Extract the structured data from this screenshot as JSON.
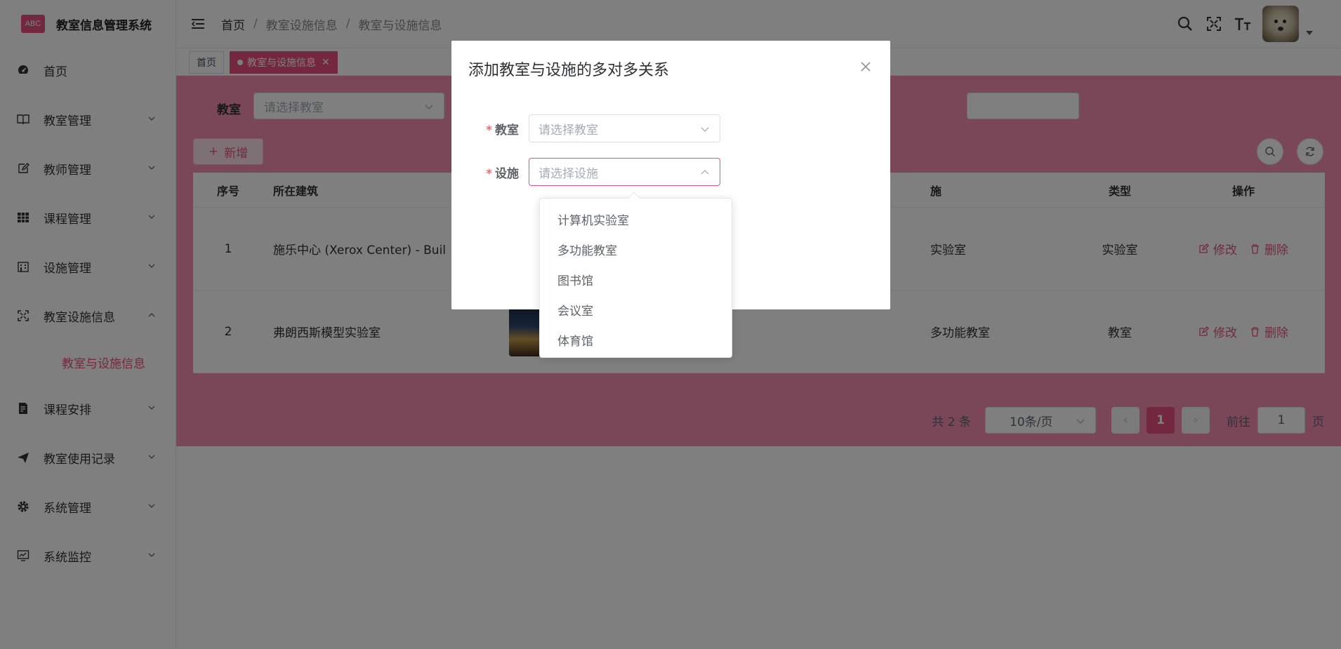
{
  "app": {
    "logo_text": "ABC",
    "title": "教室信息管理系统"
  },
  "sidebar": {
    "items": [
      {
        "label": "首页",
        "icon": "dashboard-icon",
        "expandable": false
      },
      {
        "label": "教室管理",
        "icon": "book-icon",
        "expandable": true
      },
      {
        "label": "教师管理",
        "icon": "edit-icon",
        "expandable": true
      },
      {
        "label": "课程管理",
        "icon": "table-icon",
        "expandable": true
      },
      {
        "label": "设施管理",
        "icon": "building-icon",
        "expandable": true
      },
      {
        "label": "教室设施信息",
        "icon": "fullscreen-icon",
        "expandable": true,
        "expanded": true
      },
      {
        "label": "课程安排",
        "icon": "document-icon",
        "expandable": true
      },
      {
        "label": "教室使用记录",
        "icon": "send-icon",
        "expandable": true
      },
      {
        "label": "系统管理",
        "icon": "gear-icon",
        "expandable": true
      },
      {
        "label": "系统监控",
        "icon": "monitor-icon",
        "expandable": true
      }
    ],
    "active_sub": "教室与设施信息"
  },
  "header": {
    "breadcrumb": [
      "首页",
      "教室设施信息",
      "教室与设施信息"
    ],
    "separator": "/"
  },
  "tags": {
    "home": "首页",
    "active": "教室与设施信息"
  },
  "filter": {
    "label": "教室",
    "placeholder": "请选择教室"
  },
  "toolbar": {
    "add_label": "新增"
  },
  "table": {
    "columns": [
      "序号",
      "所在建筑",
      "施",
      "类型",
      "操作"
    ],
    "rows": [
      {
        "idx": "1",
        "building": "施乐中心 (Xerox Center) - Buil",
        "facility": "实验室",
        "type": "实验室"
      },
      {
        "idx": "2",
        "building": "弗朗西斯模型实验室",
        "facility": "多功能教室",
        "type": "教室"
      }
    ],
    "edit_label": "修改",
    "delete_label": "删除"
  },
  "pager": {
    "total": "共 2 条",
    "page_size": "10条/页",
    "current": "1",
    "goto_label": "前往",
    "goto_value": "1",
    "page_suffix": "页"
  },
  "dialog": {
    "title": "添加教室与设施的多对多关系",
    "classroom_label": "教室",
    "classroom_placeholder": "请选择教室",
    "facility_label": "设施",
    "facility_placeholder": "请选择设施",
    "required_mark": "*"
  },
  "dropdown": {
    "options": [
      "计算机实验室",
      "多功能教室",
      "图书馆",
      "会议室",
      "体育馆"
    ]
  },
  "colors": {
    "accent": "#e8507f",
    "panel": "#f48fb1"
  }
}
